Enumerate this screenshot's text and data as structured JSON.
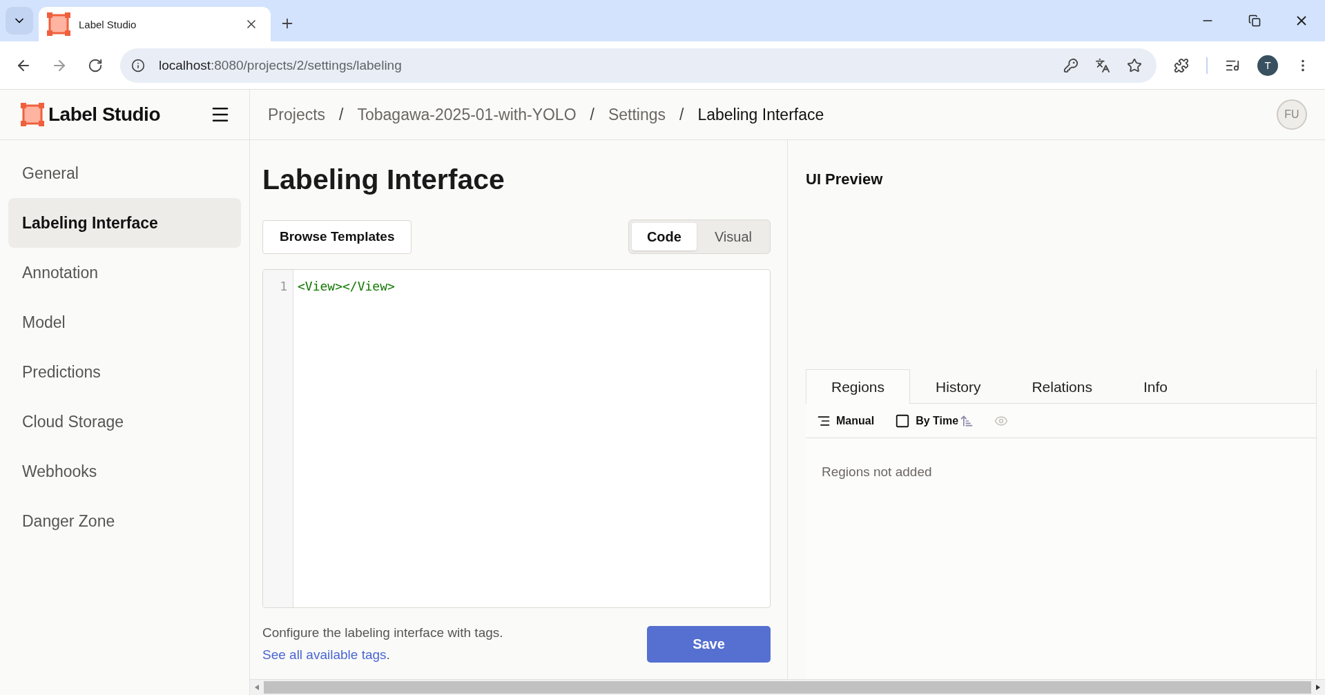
{
  "browser": {
    "tab_title": "Label Studio",
    "url_host": "localhost",
    "url_rest": ":8080/projects/2/settings/labeling",
    "profile_initial": "T"
  },
  "header": {
    "logo_text": "Label Studio",
    "breadcrumbs": [
      "Projects",
      "Tobagawa-2025-01-with-YOLO",
      "Settings",
      "Labeling Interface"
    ],
    "separator": "/",
    "avatar": "FU"
  },
  "sidebar": {
    "items": [
      {
        "label": "General",
        "selected": false
      },
      {
        "label": "Labeling Interface",
        "selected": true
      },
      {
        "label": "Annotation",
        "selected": false
      },
      {
        "label": "Model",
        "selected": false
      },
      {
        "label": "Predictions",
        "selected": false
      },
      {
        "label": "Cloud Storage",
        "selected": false
      },
      {
        "label": "Webhooks",
        "selected": false
      },
      {
        "label": "Danger Zone",
        "selected": false
      }
    ]
  },
  "main": {
    "title": "Labeling Interface",
    "browse_button": "Browse Templates",
    "modes": [
      {
        "label": "Code",
        "selected": true
      },
      {
        "label": "Visual",
        "selected": false
      }
    ],
    "editor": {
      "lines": [
        {
          "number": "1",
          "code": "<View></View>"
        }
      ]
    },
    "help_text": "Configure the labeling interface with tags.",
    "help_link": "See all available tags",
    "help_suffix": ".",
    "save_button": "Save"
  },
  "preview": {
    "title": "UI Preview",
    "tabs": [
      {
        "label": "Regions",
        "selected": true
      },
      {
        "label": "History",
        "selected": false
      },
      {
        "label": "Relations",
        "selected": false
      },
      {
        "label": "Info",
        "selected": false
      }
    ],
    "toolbar": [
      {
        "kind": "order",
        "label": "Manual"
      },
      {
        "kind": "sort",
        "label": "By Time"
      },
      {
        "kind": "visibility",
        "disabled": true
      }
    ],
    "empty_text": "Regions not added"
  }
}
